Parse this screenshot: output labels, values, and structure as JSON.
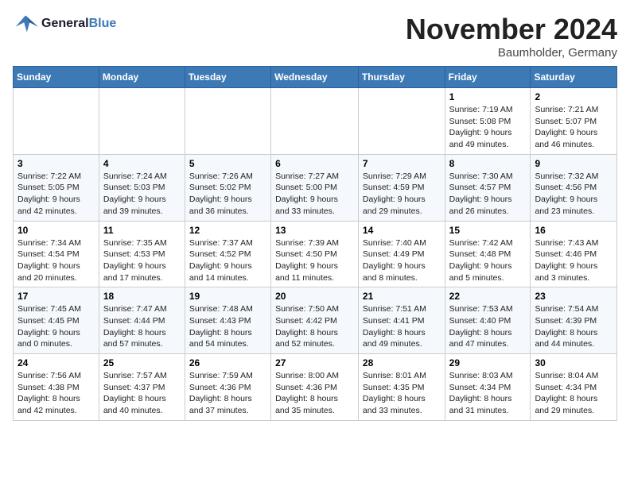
{
  "logo": {
    "text_general": "General",
    "text_blue": "Blue"
  },
  "header": {
    "month_year": "November 2024",
    "location": "Baumholder, Germany"
  },
  "weekdays": [
    "Sunday",
    "Monday",
    "Tuesday",
    "Wednesday",
    "Thursday",
    "Friday",
    "Saturday"
  ],
  "weeks": [
    [
      {
        "day": "",
        "info": ""
      },
      {
        "day": "",
        "info": ""
      },
      {
        "day": "",
        "info": ""
      },
      {
        "day": "",
        "info": ""
      },
      {
        "day": "",
        "info": ""
      },
      {
        "day": "1",
        "info": "Sunrise: 7:19 AM\nSunset: 5:08 PM\nDaylight: 9 hours and 49 minutes."
      },
      {
        "day": "2",
        "info": "Sunrise: 7:21 AM\nSunset: 5:07 PM\nDaylight: 9 hours and 46 minutes."
      }
    ],
    [
      {
        "day": "3",
        "info": "Sunrise: 7:22 AM\nSunset: 5:05 PM\nDaylight: 9 hours and 42 minutes."
      },
      {
        "day": "4",
        "info": "Sunrise: 7:24 AM\nSunset: 5:03 PM\nDaylight: 9 hours and 39 minutes."
      },
      {
        "day": "5",
        "info": "Sunrise: 7:26 AM\nSunset: 5:02 PM\nDaylight: 9 hours and 36 minutes."
      },
      {
        "day": "6",
        "info": "Sunrise: 7:27 AM\nSunset: 5:00 PM\nDaylight: 9 hours and 33 minutes."
      },
      {
        "day": "7",
        "info": "Sunrise: 7:29 AM\nSunset: 4:59 PM\nDaylight: 9 hours and 29 minutes."
      },
      {
        "day": "8",
        "info": "Sunrise: 7:30 AM\nSunset: 4:57 PM\nDaylight: 9 hours and 26 minutes."
      },
      {
        "day": "9",
        "info": "Sunrise: 7:32 AM\nSunset: 4:56 PM\nDaylight: 9 hours and 23 minutes."
      }
    ],
    [
      {
        "day": "10",
        "info": "Sunrise: 7:34 AM\nSunset: 4:54 PM\nDaylight: 9 hours and 20 minutes."
      },
      {
        "day": "11",
        "info": "Sunrise: 7:35 AM\nSunset: 4:53 PM\nDaylight: 9 hours and 17 minutes."
      },
      {
        "day": "12",
        "info": "Sunrise: 7:37 AM\nSunset: 4:52 PM\nDaylight: 9 hours and 14 minutes."
      },
      {
        "day": "13",
        "info": "Sunrise: 7:39 AM\nSunset: 4:50 PM\nDaylight: 9 hours and 11 minutes."
      },
      {
        "day": "14",
        "info": "Sunrise: 7:40 AM\nSunset: 4:49 PM\nDaylight: 9 hours and 8 minutes."
      },
      {
        "day": "15",
        "info": "Sunrise: 7:42 AM\nSunset: 4:48 PM\nDaylight: 9 hours and 5 minutes."
      },
      {
        "day": "16",
        "info": "Sunrise: 7:43 AM\nSunset: 4:46 PM\nDaylight: 9 hours and 3 minutes."
      }
    ],
    [
      {
        "day": "17",
        "info": "Sunrise: 7:45 AM\nSunset: 4:45 PM\nDaylight: 9 hours and 0 minutes."
      },
      {
        "day": "18",
        "info": "Sunrise: 7:47 AM\nSunset: 4:44 PM\nDaylight: 8 hours and 57 minutes."
      },
      {
        "day": "19",
        "info": "Sunrise: 7:48 AM\nSunset: 4:43 PM\nDaylight: 8 hours and 54 minutes."
      },
      {
        "day": "20",
        "info": "Sunrise: 7:50 AM\nSunset: 4:42 PM\nDaylight: 8 hours and 52 minutes."
      },
      {
        "day": "21",
        "info": "Sunrise: 7:51 AM\nSunset: 4:41 PM\nDaylight: 8 hours and 49 minutes."
      },
      {
        "day": "22",
        "info": "Sunrise: 7:53 AM\nSunset: 4:40 PM\nDaylight: 8 hours and 47 minutes."
      },
      {
        "day": "23",
        "info": "Sunrise: 7:54 AM\nSunset: 4:39 PM\nDaylight: 8 hours and 44 minutes."
      }
    ],
    [
      {
        "day": "24",
        "info": "Sunrise: 7:56 AM\nSunset: 4:38 PM\nDaylight: 8 hours and 42 minutes."
      },
      {
        "day": "25",
        "info": "Sunrise: 7:57 AM\nSunset: 4:37 PM\nDaylight: 8 hours and 40 minutes."
      },
      {
        "day": "26",
        "info": "Sunrise: 7:59 AM\nSunset: 4:36 PM\nDaylight: 8 hours and 37 minutes."
      },
      {
        "day": "27",
        "info": "Sunrise: 8:00 AM\nSunset: 4:36 PM\nDaylight: 8 hours and 35 minutes."
      },
      {
        "day": "28",
        "info": "Sunrise: 8:01 AM\nSunset: 4:35 PM\nDaylight: 8 hours and 33 minutes."
      },
      {
        "day": "29",
        "info": "Sunrise: 8:03 AM\nSunset: 4:34 PM\nDaylight: 8 hours and 31 minutes."
      },
      {
        "day": "30",
        "info": "Sunrise: 8:04 AM\nSunset: 4:34 PM\nDaylight: 8 hours and 29 minutes."
      }
    ]
  ]
}
